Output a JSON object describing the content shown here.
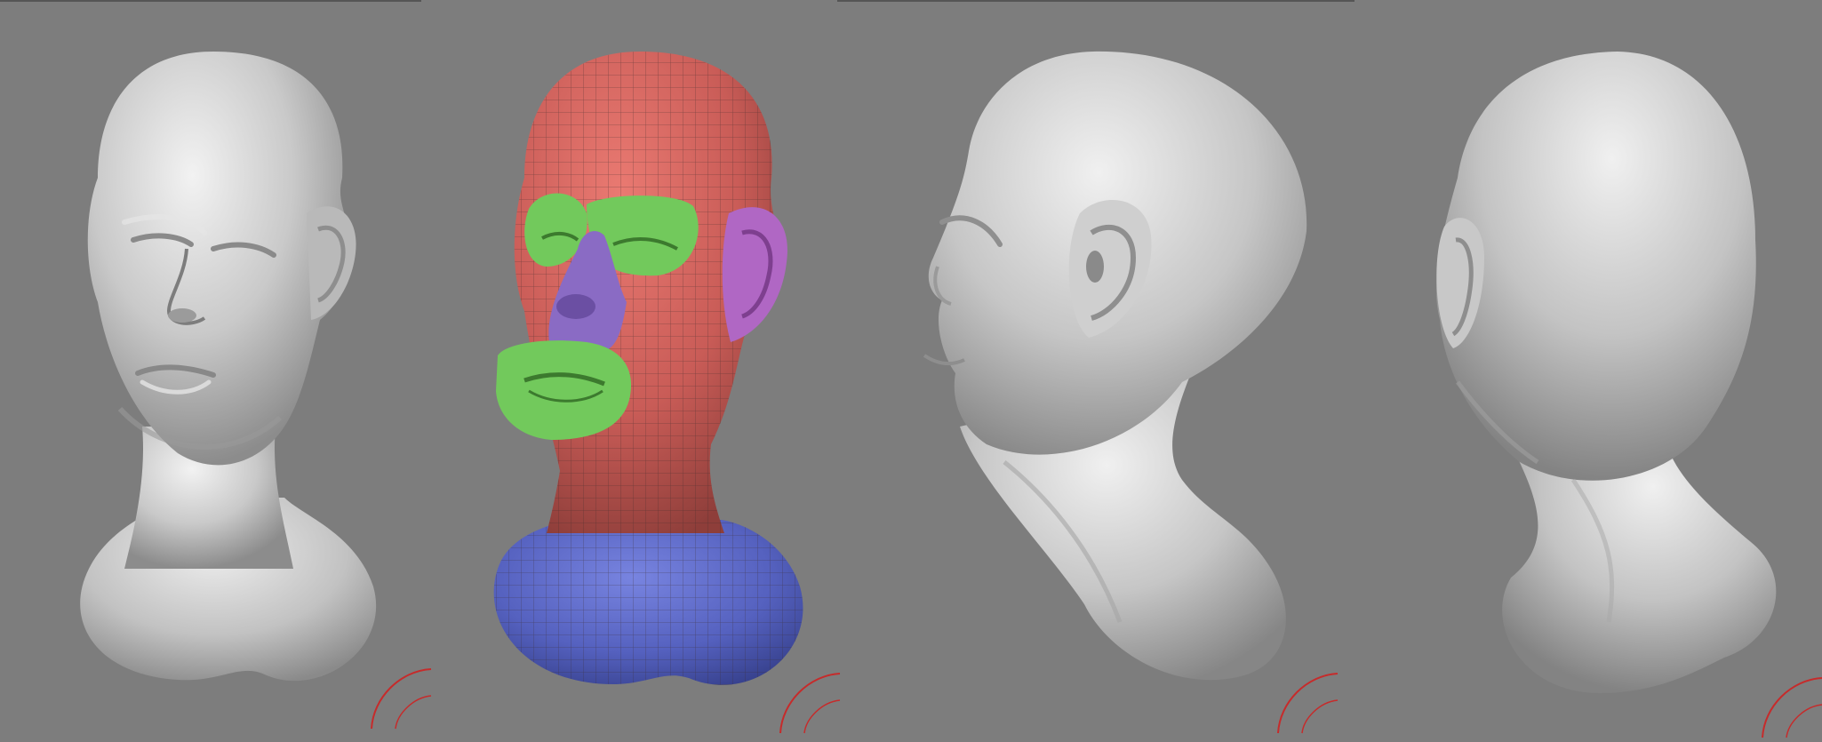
{
  "scene": {
    "background": "#7d7d7d",
    "views": [
      {
        "name": "front-three-quarter",
        "material": "matcap-gray"
      },
      {
        "name": "polygroups",
        "material": "polygroup-colors"
      },
      {
        "name": "side-profile",
        "material": "matcap-gray"
      },
      {
        "name": "rear-three-quarter",
        "material": "matcap-gray"
      }
    ],
    "polygroup_colors": {
      "head": "#d4655f",
      "eyes": "#72c95c",
      "mouth": "#72c95c",
      "nose": "#8a6bc4",
      "ear": "#b067c4",
      "neck": "#5a67c9",
      "wire": "#3a2a2a"
    },
    "gizmo_color": "#c62b2b",
    "icons": [
      "axis-gizmo-icon",
      "axis-gizmo-icon",
      "axis-gizmo-icon",
      "axis-gizmo-icon"
    ]
  }
}
